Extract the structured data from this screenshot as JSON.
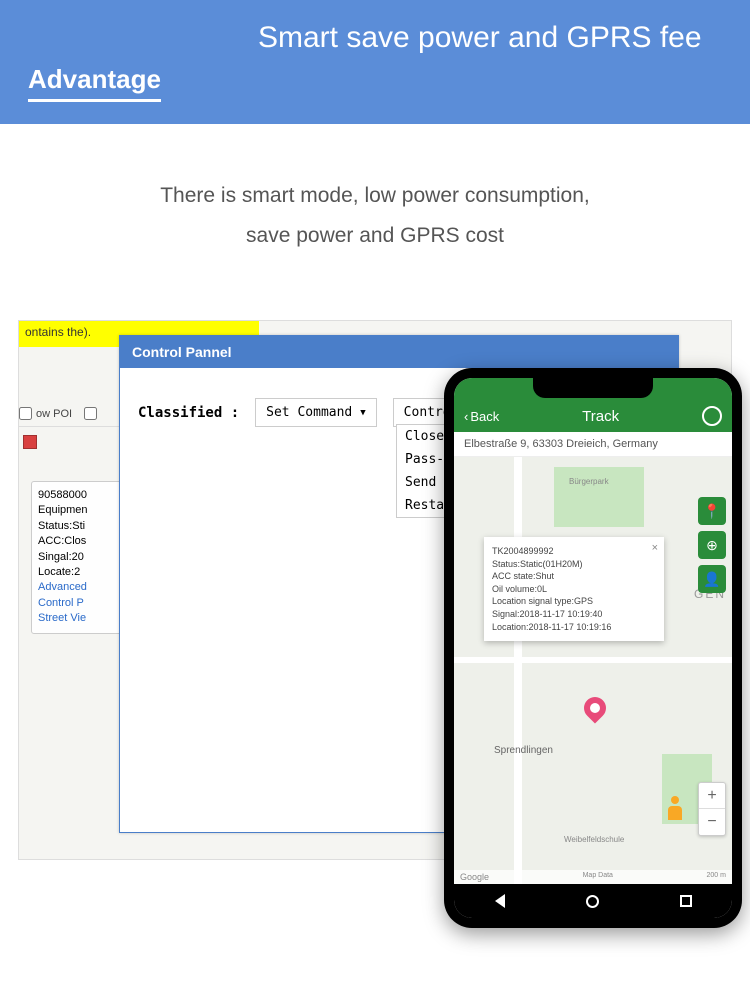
{
  "header": {
    "left_label": "Advantage",
    "right_title": "Smart save power and GPRS fee"
  },
  "subtitle": {
    "line1": "There is smart  mode,  low power  consumption,",
    "line2": "save power and  GPRS cost"
  },
  "desktop": {
    "yellow_bar": "ontains the).",
    "panel_title": "Control Pannel",
    "classified_label": "Classified :",
    "set_command": "Set Command",
    "control_command": "Control Comm",
    "menu": [
      "Close relay",
      "Pass- trough",
      "Send SMS",
      "Restart"
    ],
    "show_poi": "ow POI",
    "info": {
      "id": "90588000",
      "equipment": "Equipmen",
      "status": "Status:Sti",
      "acc": "ACC:Clos",
      "signal": "Singal:20",
      "locate": "Locate:2",
      "advanced": "Advanced",
      "control": "Control P",
      "street": "Street Vie"
    }
  },
  "phone": {
    "back": "Back",
    "title": "Track",
    "address": "Elbestraße 9, 63303 Dreieich, Germany",
    "popup": {
      "id": "TK2004899992",
      "status": "Status:Static(01H20M)",
      "acc": "ACC state:Shut",
      "oil": "Oil volume:0L",
      "signal_type": "Location signal type:GPS",
      "signal": "Signal:2018-11-17 10:19:40",
      "location": "Location:2018-11-17 10:19:16"
    },
    "map_labels": {
      "burgerpark": "Bürgerpark",
      "sprendlingen": "Sprendlingen",
      "gen": "GEN",
      "weibelfeldschule": "Weibelfeldschule"
    },
    "footer": {
      "google": "Google",
      "map_data": "Map Data",
      "scale": "200 m"
    }
  }
}
